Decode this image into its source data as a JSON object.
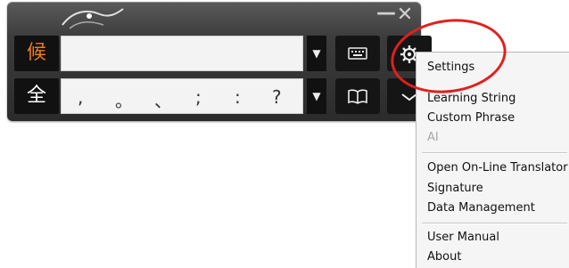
{
  "ime": {
    "candidate_mode": "候",
    "width_mode": "全",
    "punctuation": [
      ",",
      "。",
      "、",
      ";",
      ":",
      "?"
    ],
    "minimize": "—",
    "close": "✕",
    "dropdown": "▼"
  },
  "menu": {
    "items": [
      {
        "label": "Settings"
      },
      {
        "label": "Learning String"
      },
      {
        "label": "Custom Phrase"
      },
      {
        "label": "AI"
      },
      {
        "label": "Open On-Line Translator"
      },
      {
        "label": "Signature"
      },
      {
        "label": "Data Management"
      },
      {
        "label": "User Manual"
      },
      {
        "label": "About"
      }
    ]
  },
  "colors": {
    "annotation": "#e0201c",
    "mode_accent": "#e97b20",
    "disabled": "#a8a8a8"
  }
}
